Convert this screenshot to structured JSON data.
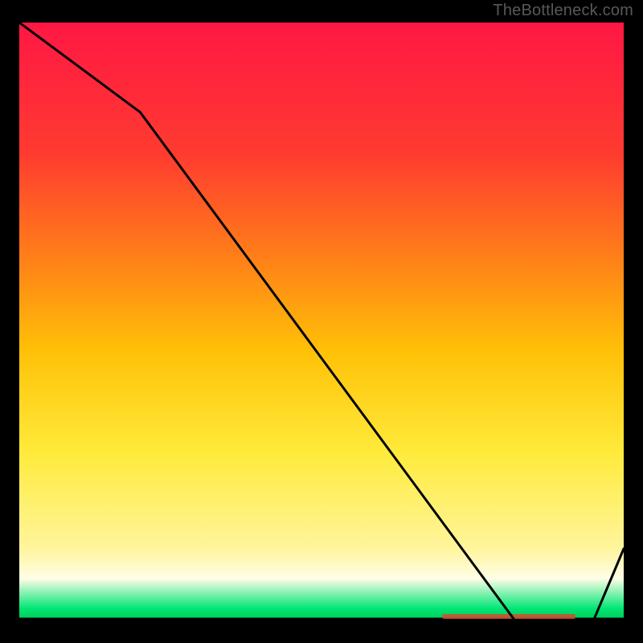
{
  "attribution": "TheBottleneck.com",
  "chart_data": {
    "type": "line",
    "title": "",
    "xlabel": "",
    "ylabel": "",
    "xlim": [
      0,
      100
    ],
    "ylim": [
      0,
      100
    ],
    "x": [
      0,
      20,
      82,
      95,
      100
    ],
    "values": [
      100,
      85,
      0,
      0,
      12
    ],
    "optimal_band": {
      "x_start": 70,
      "x_end": 92,
      "label": ""
    },
    "gradient_stops": [
      {
        "offset": 0.0,
        "color": "#ff1744"
      },
      {
        "offset": 0.22,
        "color": "#ff3b30"
      },
      {
        "offset": 0.38,
        "color": "#ff7a1a"
      },
      {
        "offset": 0.55,
        "color": "#ffc107"
      },
      {
        "offset": 0.72,
        "color": "#ffeb3b"
      },
      {
        "offset": 0.88,
        "color": "#fff59d"
      },
      {
        "offset": 0.93,
        "color": "#fffde7"
      },
      {
        "offset": 0.98,
        "color": "#00e676"
      },
      {
        "offset": 1.0,
        "color": "#00c853"
      }
    ],
    "line_color": "#000000",
    "bottom_rule_color": "#000000"
  }
}
